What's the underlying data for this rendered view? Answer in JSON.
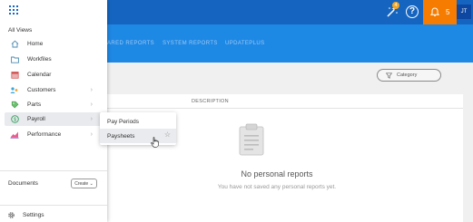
{
  "header": {
    "notification_badge": "4",
    "notification_count": "5",
    "avatar_initials": "JT",
    "colors": {
      "bar": "#1565c0",
      "tabbar": "#1e88e5",
      "notify": "#f57c00"
    }
  },
  "tabs": [
    {
      "label": "ARED REPORTS"
    },
    {
      "label": "SYSTEM REPORTS"
    },
    {
      "label": "UPDATEPLUS"
    }
  ],
  "main": {
    "category_label": "Category",
    "column_header": "DESCRIPTION",
    "empty_title": "No personal reports",
    "empty_subtitle": "You have not saved any personal reports yet."
  },
  "sidebar": {
    "section_title": "All Views",
    "items": [
      {
        "label": "Home",
        "icon": "home-icon"
      },
      {
        "label": "Workfiles",
        "icon": "folder-icon"
      },
      {
        "label": "Calendar",
        "icon": "calendar-icon"
      },
      {
        "label": "Customers",
        "icon": "customers-icon"
      },
      {
        "label": "Parts",
        "icon": "parts-icon"
      },
      {
        "label": "Payroll",
        "icon": "payroll-icon"
      },
      {
        "label": "Performance",
        "icon": "performance-icon"
      }
    ],
    "documents_label": "Documents",
    "create_label": "Create ⌄",
    "settings_label": "Settings"
  },
  "submenu": {
    "items": [
      {
        "label": "Pay Periods"
      },
      {
        "label": "Paysheets"
      }
    ]
  }
}
